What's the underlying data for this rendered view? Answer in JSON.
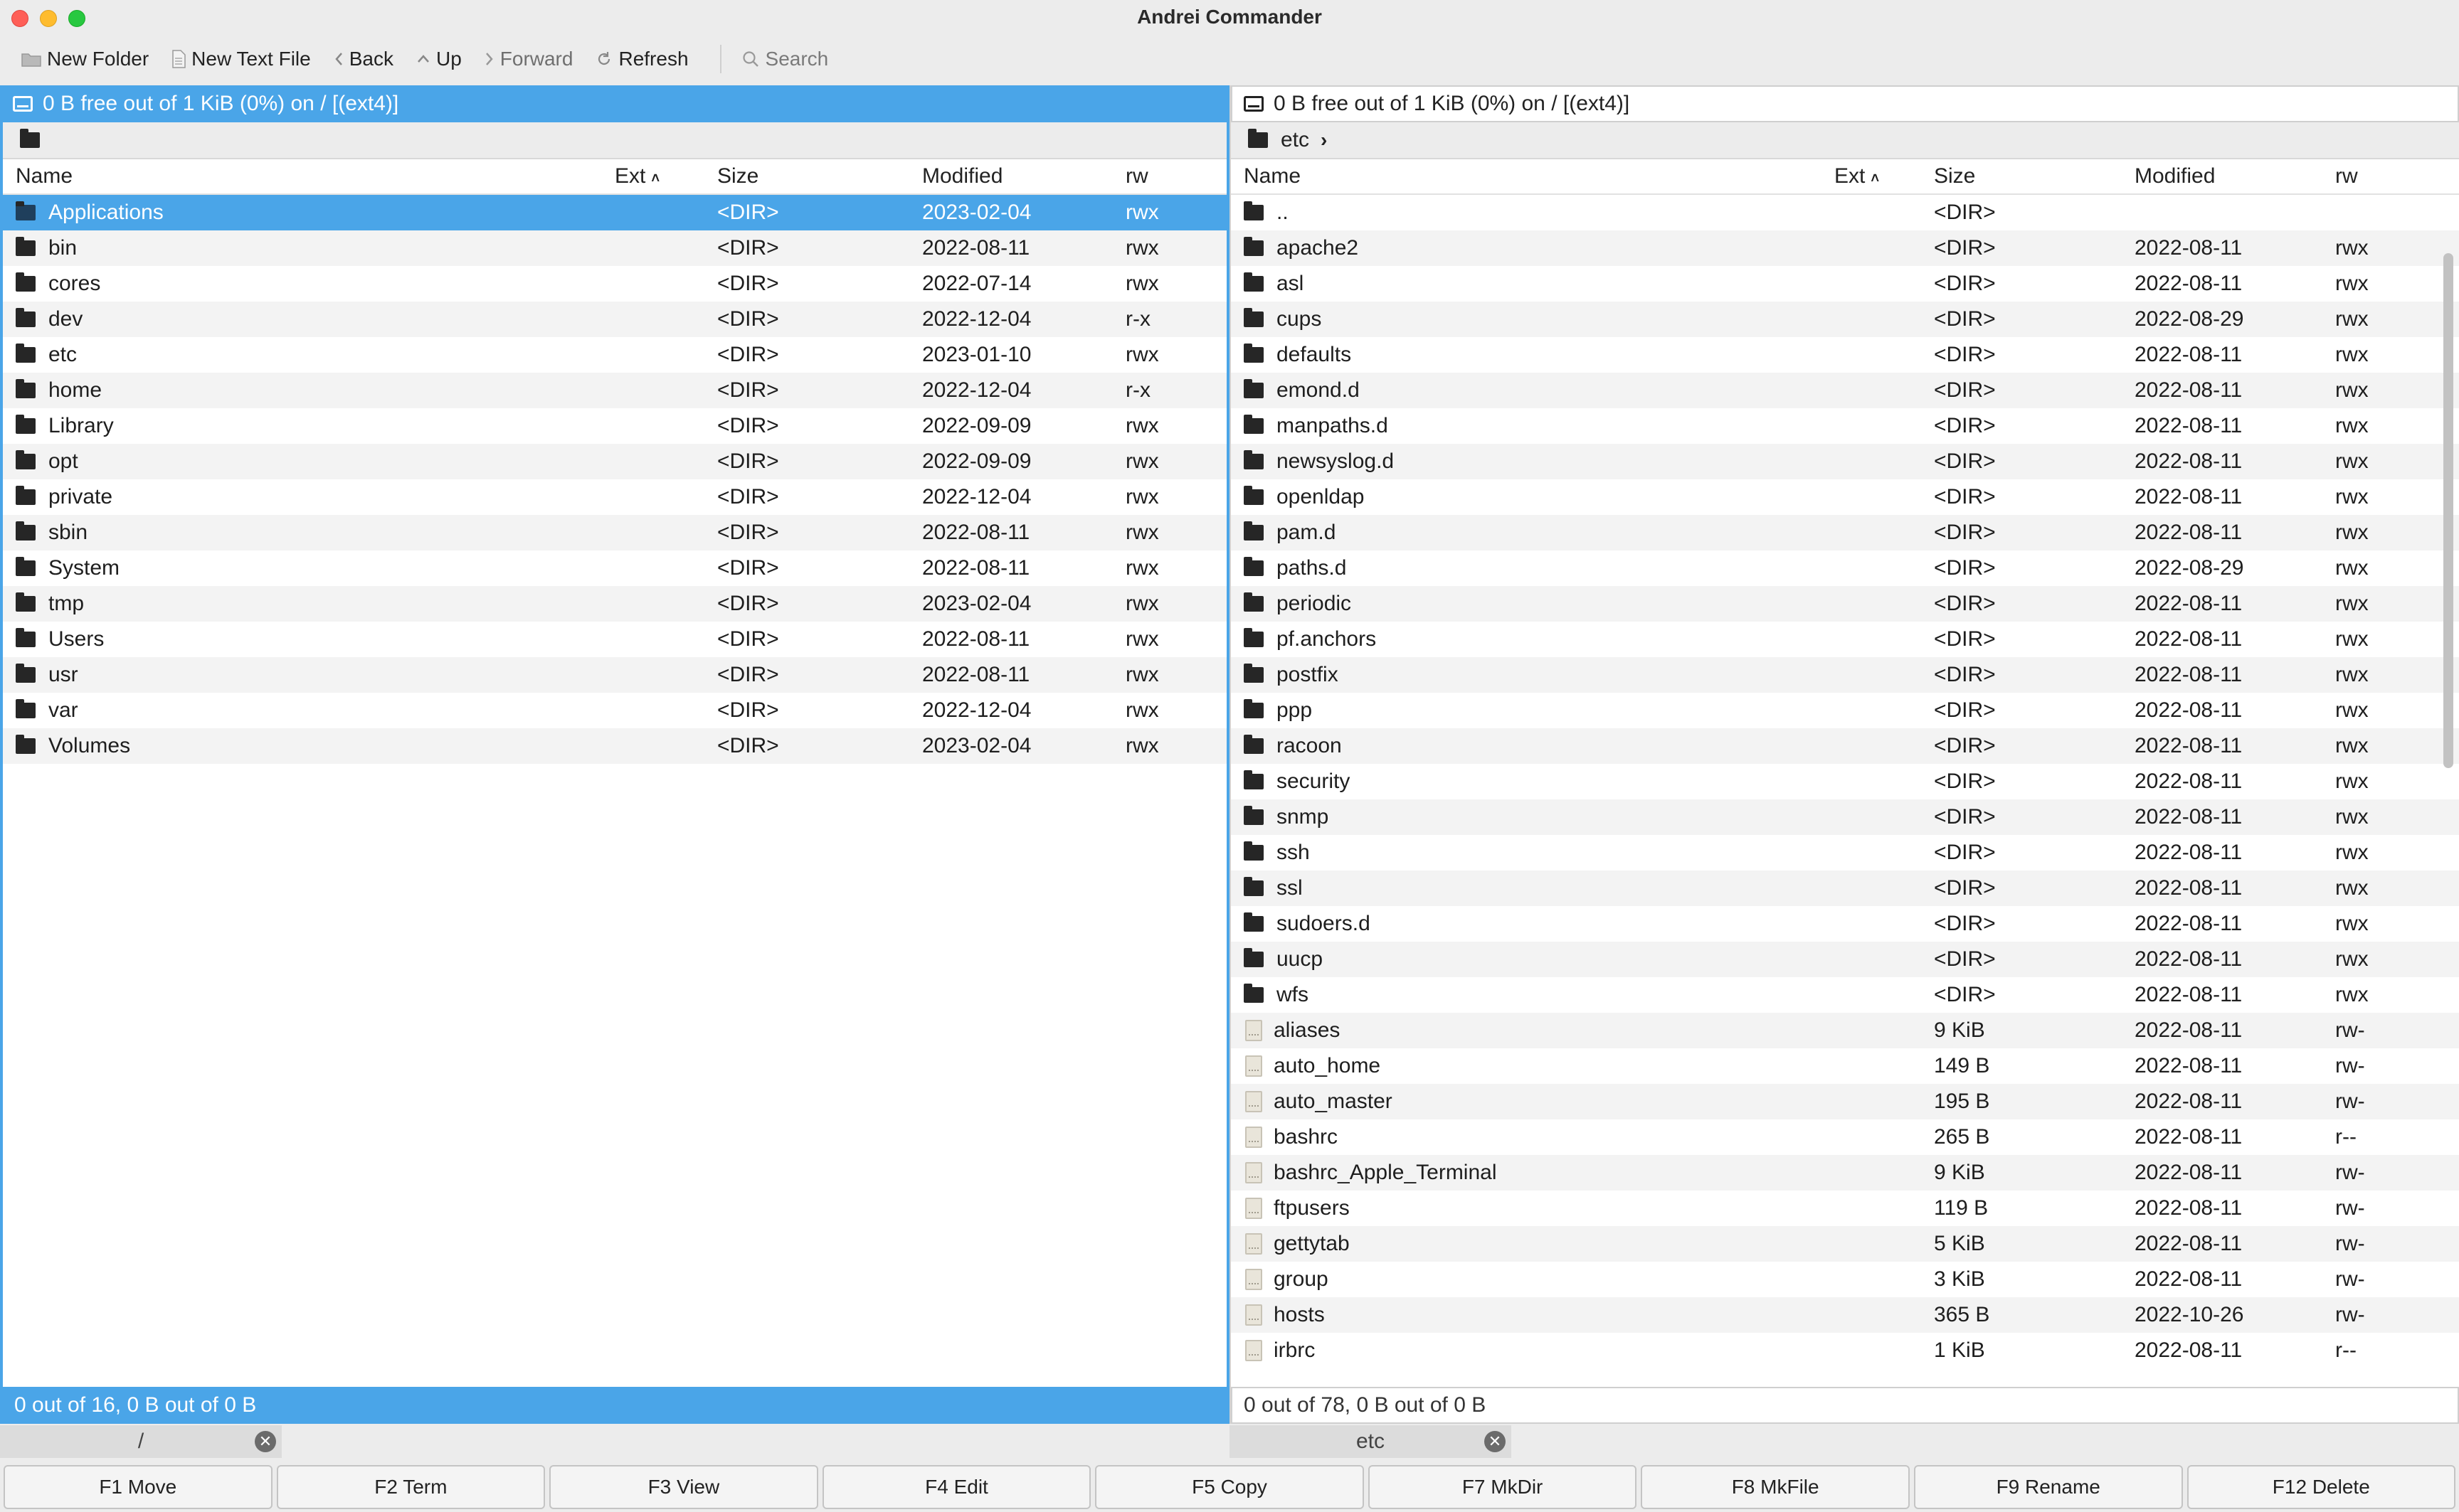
{
  "window": {
    "title": "Andrei Commander"
  },
  "toolbar": {
    "new_folder": "New Folder",
    "new_text_file": "New Text File",
    "back": "Back",
    "up": "Up",
    "forward": "Forward",
    "refresh": "Refresh",
    "search_placeholder": "Search"
  },
  "columns": {
    "name": "Name",
    "ext": "Ext",
    "size": "Size",
    "modified": "Modified",
    "rw": "rw"
  },
  "left": {
    "drive": "0 B free out of 1 KiB (0%) on / [(ext4)]",
    "path": "",
    "status": "0 out of 16, 0 B out of 0 B",
    "tab": "/",
    "rows": [
      {
        "name": "Applications",
        "size": "<DIR>",
        "modified": "2023-02-04",
        "rw": "rwx",
        "dir": true,
        "selected": true
      },
      {
        "name": "bin",
        "size": "<DIR>",
        "modified": "2022-08-11",
        "rw": "rwx",
        "dir": true
      },
      {
        "name": "cores",
        "size": "<DIR>",
        "modified": "2022-07-14",
        "rw": "rwx",
        "dir": true
      },
      {
        "name": "dev",
        "size": "<DIR>",
        "modified": "2022-12-04",
        "rw": "r-x",
        "dir": true
      },
      {
        "name": "etc",
        "size": "<DIR>",
        "modified": "2023-01-10",
        "rw": "rwx",
        "dir": true
      },
      {
        "name": "home",
        "size": "<DIR>",
        "modified": "2022-12-04",
        "rw": "r-x",
        "dir": true
      },
      {
        "name": "Library",
        "size": "<DIR>",
        "modified": "2022-09-09",
        "rw": "rwx",
        "dir": true
      },
      {
        "name": "opt",
        "size": "<DIR>",
        "modified": "2022-09-09",
        "rw": "rwx",
        "dir": true
      },
      {
        "name": "private",
        "size": "<DIR>",
        "modified": "2022-12-04",
        "rw": "rwx",
        "dir": true
      },
      {
        "name": "sbin",
        "size": "<DIR>",
        "modified": "2022-08-11",
        "rw": "rwx",
        "dir": true
      },
      {
        "name": "System",
        "size": "<DIR>",
        "modified": "2022-08-11",
        "rw": "rwx",
        "dir": true
      },
      {
        "name": "tmp",
        "size": "<DIR>",
        "modified": "2023-02-04",
        "rw": "rwx",
        "dir": true
      },
      {
        "name": "Users",
        "size": "<DIR>",
        "modified": "2022-08-11",
        "rw": "rwx",
        "dir": true
      },
      {
        "name": "usr",
        "size": "<DIR>",
        "modified": "2022-08-11",
        "rw": "rwx",
        "dir": true
      },
      {
        "name": "var",
        "size": "<DIR>",
        "modified": "2022-12-04",
        "rw": "rwx",
        "dir": true
      },
      {
        "name": "Volumes",
        "size": "<DIR>",
        "modified": "2023-02-04",
        "rw": "rwx",
        "dir": true
      }
    ]
  },
  "right": {
    "drive": "0 B free out of 1 KiB (0%) on / [(ext4)]",
    "path": "etc",
    "status": "0 out of 78, 0 B out of 0 B",
    "tab": "etc",
    "rows": [
      {
        "name": "..",
        "size": "<DIR>",
        "modified": "",
        "rw": "",
        "dir": true
      },
      {
        "name": "apache2",
        "size": "<DIR>",
        "modified": "2022-08-11",
        "rw": "rwx",
        "dir": true
      },
      {
        "name": "asl",
        "size": "<DIR>",
        "modified": "2022-08-11",
        "rw": "rwx",
        "dir": true
      },
      {
        "name": "cups",
        "size": "<DIR>",
        "modified": "2022-08-29",
        "rw": "rwx",
        "dir": true
      },
      {
        "name": "defaults",
        "size": "<DIR>",
        "modified": "2022-08-11",
        "rw": "rwx",
        "dir": true
      },
      {
        "name": "emond.d",
        "size": "<DIR>",
        "modified": "2022-08-11",
        "rw": "rwx",
        "dir": true
      },
      {
        "name": "manpaths.d",
        "size": "<DIR>",
        "modified": "2022-08-11",
        "rw": "rwx",
        "dir": true
      },
      {
        "name": "newsyslog.d",
        "size": "<DIR>",
        "modified": "2022-08-11",
        "rw": "rwx",
        "dir": true
      },
      {
        "name": "openldap",
        "size": "<DIR>",
        "modified": "2022-08-11",
        "rw": "rwx",
        "dir": true
      },
      {
        "name": "pam.d",
        "size": "<DIR>",
        "modified": "2022-08-11",
        "rw": "rwx",
        "dir": true
      },
      {
        "name": "paths.d",
        "size": "<DIR>",
        "modified": "2022-08-29",
        "rw": "rwx",
        "dir": true
      },
      {
        "name": "periodic",
        "size": "<DIR>",
        "modified": "2022-08-11",
        "rw": "rwx",
        "dir": true
      },
      {
        "name": "pf.anchors",
        "size": "<DIR>",
        "modified": "2022-08-11",
        "rw": "rwx",
        "dir": true
      },
      {
        "name": "postfix",
        "size": "<DIR>",
        "modified": "2022-08-11",
        "rw": "rwx",
        "dir": true
      },
      {
        "name": "ppp",
        "size": "<DIR>",
        "modified": "2022-08-11",
        "rw": "rwx",
        "dir": true
      },
      {
        "name": "racoon",
        "size": "<DIR>",
        "modified": "2022-08-11",
        "rw": "rwx",
        "dir": true
      },
      {
        "name": "security",
        "size": "<DIR>",
        "modified": "2022-08-11",
        "rw": "rwx",
        "dir": true
      },
      {
        "name": "snmp",
        "size": "<DIR>",
        "modified": "2022-08-11",
        "rw": "rwx",
        "dir": true
      },
      {
        "name": "ssh",
        "size": "<DIR>",
        "modified": "2022-08-11",
        "rw": "rwx",
        "dir": true
      },
      {
        "name": "ssl",
        "size": "<DIR>",
        "modified": "2022-08-11",
        "rw": "rwx",
        "dir": true
      },
      {
        "name": "sudoers.d",
        "size": "<DIR>",
        "modified": "2022-08-11",
        "rw": "rwx",
        "dir": true
      },
      {
        "name": "uucp",
        "size": "<DIR>",
        "modified": "2022-08-11",
        "rw": "rwx",
        "dir": true
      },
      {
        "name": "wfs",
        "size": "<DIR>",
        "modified": "2022-08-11",
        "rw": "rwx",
        "dir": true
      },
      {
        "name": "aliases",
        "size": "9 KiB",
        "modified": "2022-08-11",
        "rw": "rw-",
        "dir": false
      },
      {
        "name": "auto_home",
        "size": "149 B",
        "modified": "2022-08-11",
        "rw": "rw-",
        "dir": false
      },
      {
        "name": "auto_master",
        "size": "195 B",
        "modified": "2022-08-11",
        "rw": "rw-",
        "dir": false
      },
      {
        "name": "bashrc",
        "size": "265 B",
        "modified": "2022-08-11",
        "rw": "r--",
        "dir": false
      },
      {
        "name": "bashrc_Apple_Terminal",
        "size": "9 KiB",
        "modified": "2022-08-11",
        "rw": "rw-",
        "dir": false
      },
      {
        "name": "ftpusers",
        "size": "119 B",
        "modified": "2022-08-11",
        "rw": "rw-",
        "dir": false
      },
      {
        "name": "gettytab",
        "size": "5 KiB",
        "modified": "2022-08-11",
        "rw": "rw-",
        "dir": false
      },
      {
        "name": "group",
        "size": "3 KiB",
        "modified": "2022-08-11",
        "rw": "rw-",
        "dir": false
      },
      {
        "name": "hosts",
        "size": "365 B",
        "modified": "2022-10-26",
        "rw": "rw-",
        "dir": false
      },
      {
        "name": "irbrc",
        "size": "1 KiB",
        "modified": "2022-08-11",
        "rw": "r--",
        "dir": false
      }
    ]
  },
  "fkeys": [
    {
      "id": "move",
      "label": "F1 Move"
    },
    {
      "id": "term",
      "label": "F2 Term"
    },
    {
      "id": "view",
      "label": "F3 View"
    },
    {
      "id": "edit",
      "label": "F4 Edit"
    },
    {
      "id": "copy",
      "label": "F5 Copy"
    },
    {
      "id": "mkdir",
      "label": "F7 MkDir"
    },
    {
      "id": "mkfile",
      "label": "F8 MkFile"
    },
    {
      "id": "rename",
      "label": "F9 Rename"
    },
    {
      "id": "delete",
      "label": "F12 Delete"
    }
  ],
  "colors": {
    "accent": "#4aa5e8",
    "stripe": "#f3f3f3"
  }
}
